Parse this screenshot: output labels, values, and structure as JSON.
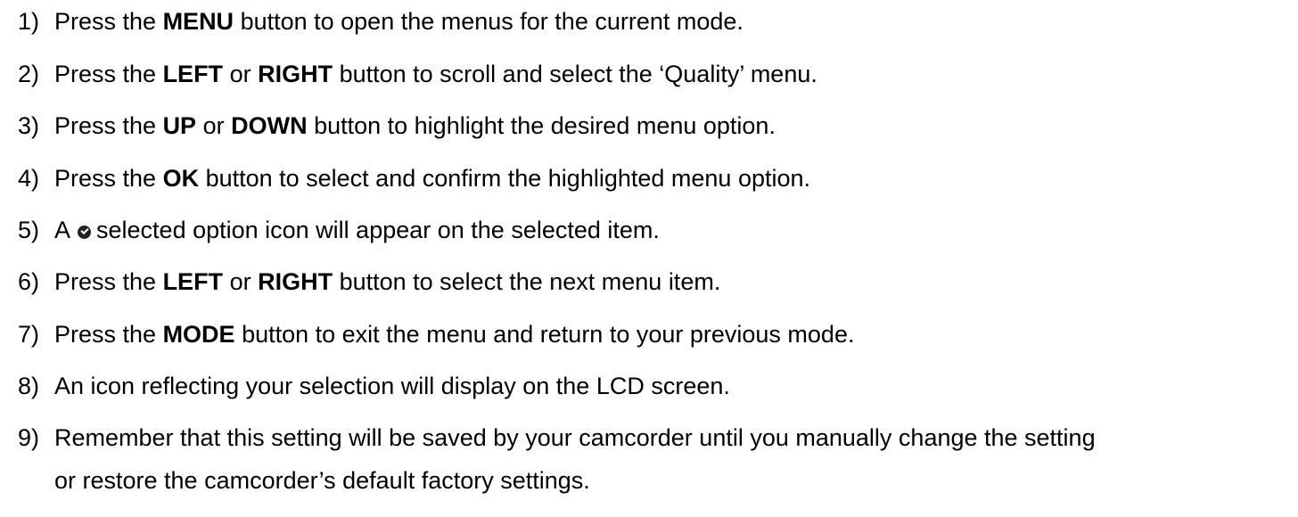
{
  "steps": [
    {
      "num": "1)",
      "t1": "Press the ",
      "b1": "MENU",
      "t2": " button to open the menus for the current mode."
    },
    {
      "num": "2)",
      "t1": "Press the ",
      "b1": "LEFT",
      "t2": " or ",
      "b2": "RIGHT",
      "t3": " button to scroll and select the ‘Quality’ menu."
    },
    {
      "num": "3)",
      "t1": "Press the ",
      "b1": "UP",
      "t2": " or ",
      "b2": "DOWN",
      "t3": " button to highlight the desired menu option."
    },
    {
      "num": "4)",
      "t1": "Press the ",
      "b1": "OK",
      "t2": " button to select and confirm the highlighted menu option."
    },
    {
      "num": "5)",
      "t1": "A",
      "t2": "selected option icon will appear on the selected item.",
      "icon": "selected-option-check-icon"
    },
    {
      "num": "6)",
      "t1": "Press the ",
      "b1": "LEFT",
      "t2": " or ",
      "b2": "RIGHT",
      "t3": " button to select the next menu item."
    },
    {
      "num": "7)",
      "t1": "Press the ",
      "b1": "MODE",
      "t2": " button to exit the menu and return to your previous mode."
    },
    {
      "num": "8)",
      "t1": "An icon reflecting your selection will display on the LCD screen."
    },
    {
      "num": "9)",
      "t1": "Remember that this setting will be saved by your camcorder until you manually change the setting",
      "t2": "or restore the camcorder’s default factory settings."
    }
  ]
}
